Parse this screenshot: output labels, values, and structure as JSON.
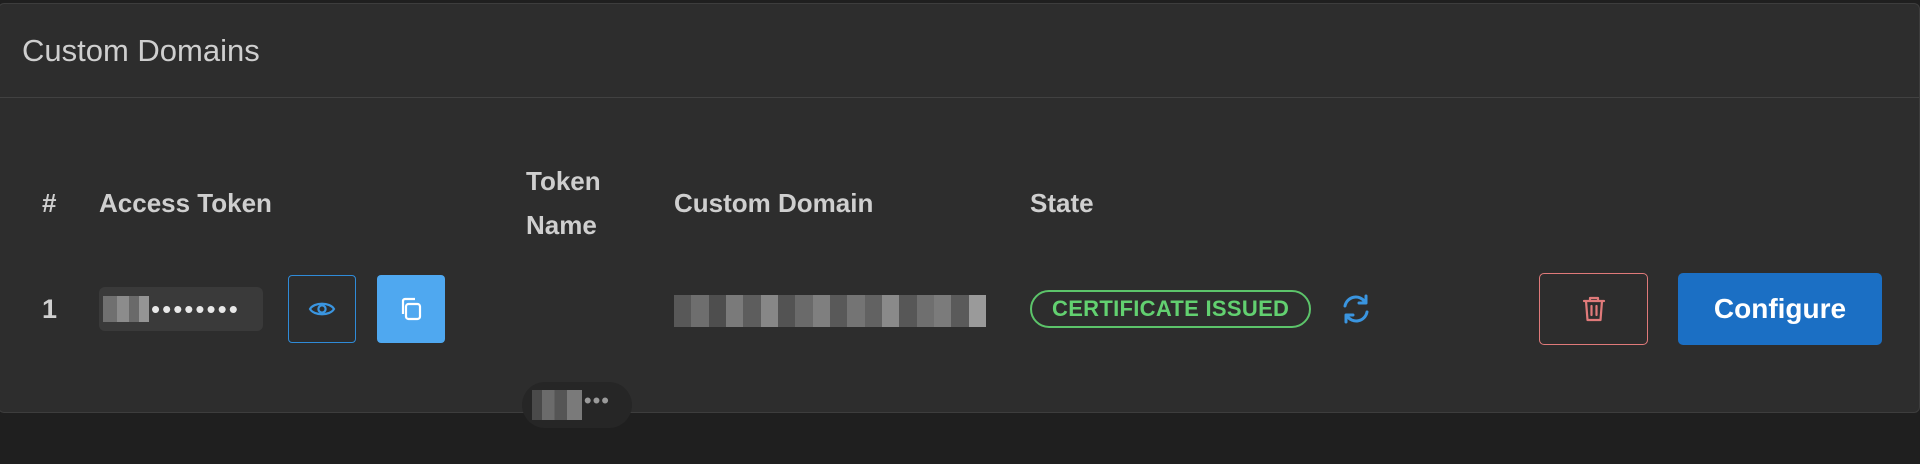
{
  "card": {
    "title": "Custom Domains"
  },
  "table": {
    "headers": {
      "index": "#",
      "access_token": "Access Token",
      "token_name_line1": "Token",
      "token_name_line2": "Name",
      "custom_domain": "Custom Domain",
      "state": "State"
    },
    "rows": [
      {
        "index": "1",
        "access_token_masked": "••••••••",
        "token_name_more": "•••",
        "state": "CERTIFICATE ISSUED"
      }
    ]
  },
  "actions": {
    "configure_label": "Configure"
  },
  "colors": {
    "badge_green": "#5cc46a",
    "primary_blue": "#1b6fc4",
    "accent_blue": "#4fa8f0",
    "danger_red": "#e07a7a"
  },
  "icons": {
    "reveal": "eye-icon",
    "copy": "copy-icon",
    "refresh": "refresh-icon",
    "delete": "trash-icon"
  }
}
